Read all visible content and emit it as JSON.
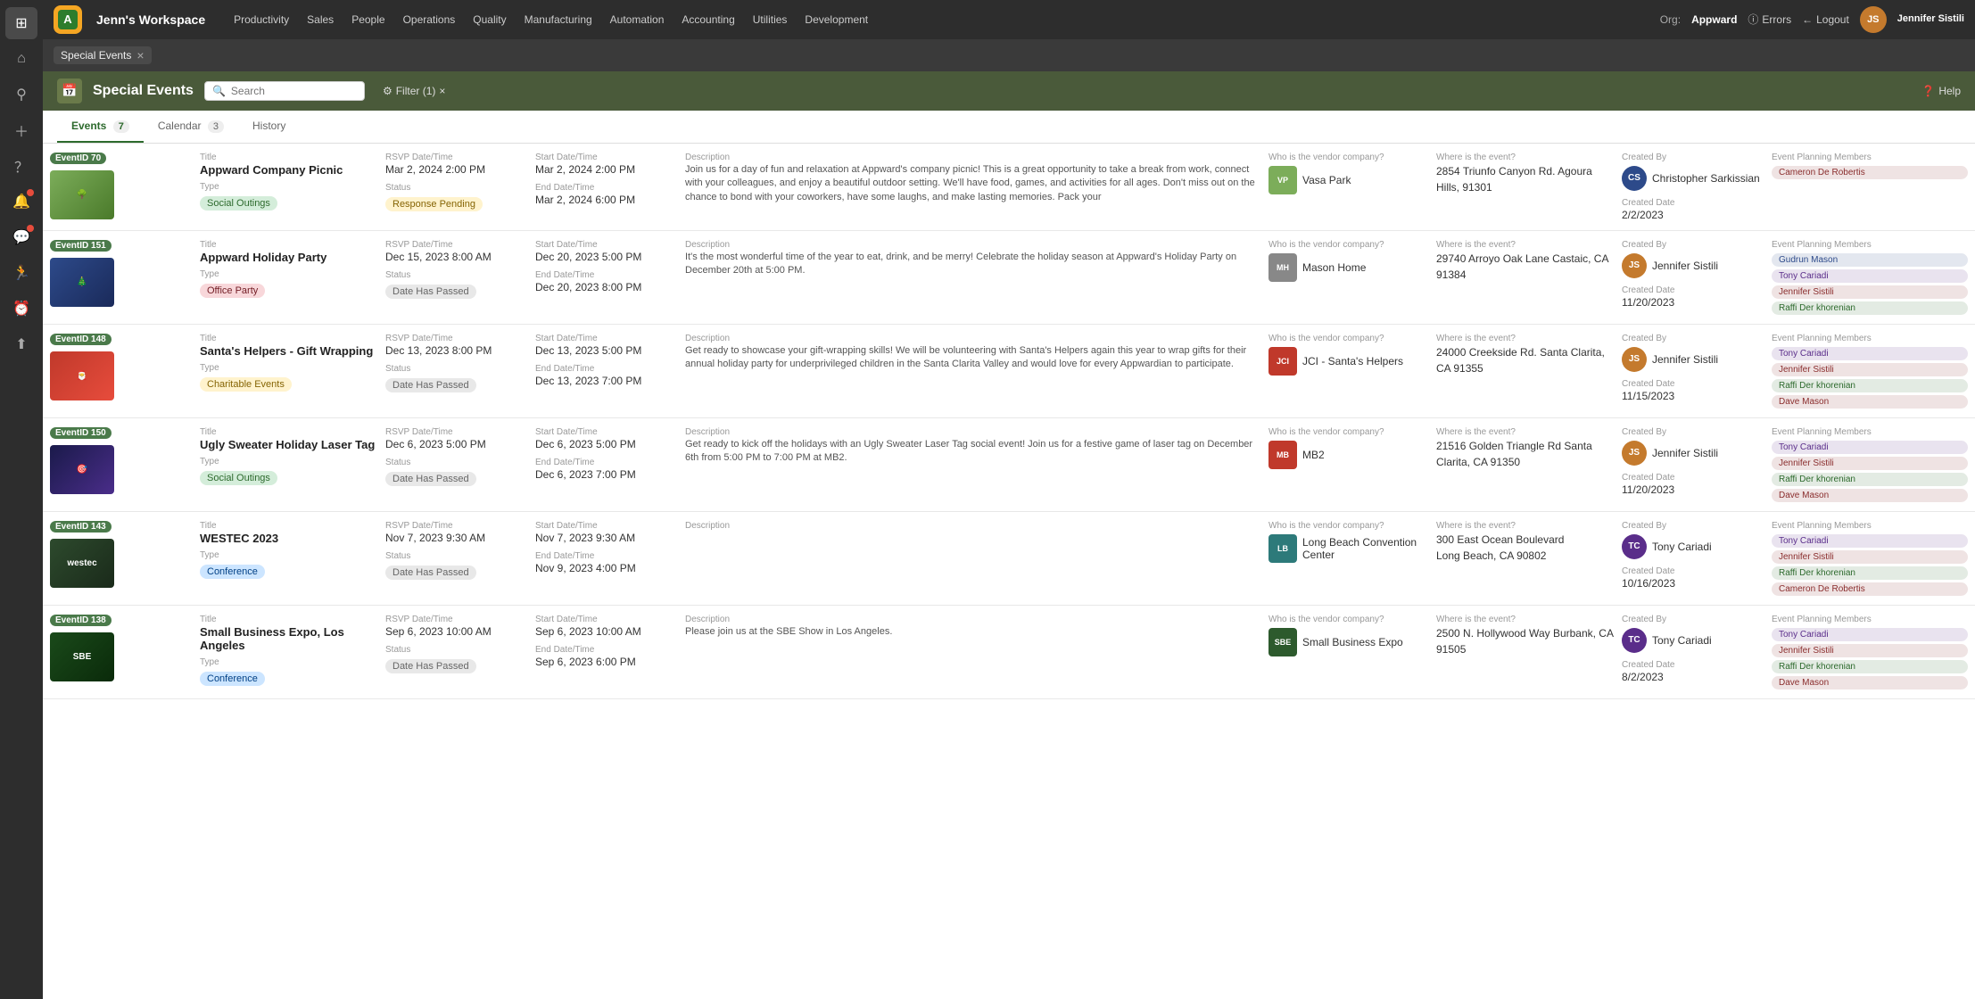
{
  "appLogo": "A",
  "workspaceName": "Jenn's Workspace",
  "nav": {
    "items": [
      {
        "label": "Productivity"
      },
      {
        "label": "Sales"
      },
      {
        "label": "People"
      },
      {
        "label": "Operations"
      },
      {
        "label": "Quality"
      },
      {
        "label": "Manufacturing"
      },
      {
        "label": "Automation"
      },
      {
        "label": "Accounting"
      },
      {
        "label": "Utilities"
      },
      {
        "label": "Development"
      }
    ],
    "org_label": "Org:",
    "org_name": "Appward",
    "errors_label": "Errors",
    "logout_label": "Logout",
    "user_name": "Jennifer Sistili"
  },
  "tagBar": {
    "chip_label": "Special Events",
    "close": "×"
  },
  "moduleHeader": {
    "title": "Special Events",
    "search_placeholder": "Search",
    "filter_label": "Filter (1)",
    "filter_close": "×",
    "help_label": "Help"
  },
  "tabs": [
    {
      "label": "Events",
      "count": "7",
      "active": true
    },
    {
      "label": "Calendar",
      "count": "3",
      "active": false
    },
    {
      "label": "History",
      "count": null,
      "active": false
    }
  ],
  "columnHeaders": [
    "EventID / Image",
    "Title / Type",
    "RSVP Date/Time",
    "Start Date/Time",
    "Description",
    "Who is the vendor company?",
    "Where is the event?",
    "Created By",
    "Event Planning Members"
  ],
  "events": [
    {
      "id": "70",
      "title": "Appward Company Picnic",
      "type": "Social Outings",
      "type_class": "type-social",
      "rsvp_date": "Mar 2, 2024 2:00 PM",
      "start_date": "Mar 2, 2024 2:00 PM",
      "end_date": "Mar 2, 2024 6:00 PM",
      "status": "Response Pending",
      "status_class": "status-pending",
      "description": "Join us for a day of fun and relaxation at Appward's company picnic! This is a great opportunity to take a break from work, connect with your colleagues, and enjoy a beautiful outdoor setting. We'll have food, games, and activities for all ages. Don't miss out on the chance to bond with your coworkers, have some laughs, and make lasting memories. Pack your",
      "vendor_name": "Vasa Park",
      "vendor_color": "#7cad5a",
      "vendor_initials": "VP",
      "location": "2854 Triunfo Canyon Rd. Agoura Hills, 91301",
      "created_by": "Christopher Sarkissian",
      "created_by_initials": "CS",
      "created_by_color": "#2d4a8a",
      "created_date_label": "Created Date",
      "created_date": "2/2/2023",
      "members": [
        "Cameron De Robertis"
      ],
      "img_class": "img-picnic",
      "img_text": "🌳"
    },
    {
      "id": "151",
      "title": "Appward Holiday Party",
      "type": "Office Party",
      "type_class": "type-office",
      "rsvp_date": "Dec 15, 2023 8:00 AM",
      "start_date": "Dec 20, 2023 5:00 PM",
      "end_date": "Dec 20, 2023 8:00 PM",
      "status": "Date Has Passed",
      "status_class": "status-passed",
      "description": "It's the most wonderful time of the year to eat, drink, and be merry!\n\nCelebrate the holiday season at Appward's Holiday Party on December 20th at 5:00 PM.",
      "vendor_name": "Mason Home",
      "vendor_color": "#888",
      "vendor_initials": "MH",
      "location": "29740 Arroyo Oak Lane Castaic, CA 91384",
      "created_by": "Jennifer Sistili",
      "created_by_initials": "JS",
      "created_by_color": "#c47a2d",
      "created_date_label": "Created Date",
      "created_date": "11/20/2023",
      "members": [
        "Gudrun Mason",
        "Tony Cariadi",
        "Jennifer Sistili",
        "Raffi Der khorenian"
      ],
      "img_class": "img-holiday",
      "img_text": "🎄"
    },
    {
      "id": "148",
      "title": "Santa's Helpers - Gift Wrapping",
      "type": "Charitable Events",
      "type_class": "type-charitable",
      "rsvp_date": "Dec 13, 2023 8:00 PM",
      "start_date": "Dec 13, 2023 5:00 PM",
      "end_date": "Dec 13, 2023 7:00 PM",
      "status": "Date Has Passed",
      "status_class": "status-passed",
      "description": "Get ready to showcase your gift-wrapping skills!\n\nWe will be volunteering with Santa's Helpers again this year to wrap gifts for their annual holiday party for underprivileged children in the Santa Clarita Valley and would love for every Appwardian to participate.",
      "vendor_name": "JCI - Santa's Helpers",
      "vendor_color": "#c0392b",
      "vendor_initials": "JCI",
      "location": "24000 Creekside Rd. Santa Clarita, CA 91355",
      "created_by": "Jennifer Sistili",
      "created_by_initials": "JS",
      "created_by_color": "#c47a2d",
      "created_date_label": "Created Date",
      "created_date": "11/15/2023",
      "members": [
        "Tony Cariadi",
        "Jennifer Sistili",
        "Raffi Der khorenian",
        "Dave Mason"
      ],
      "img_class": "img-santa",
      "img_text": "🎅"
    },
    {
      "id": "150",
      "title": "Ugly Sweater Holiday Laser Tag",
      "type": "Social Outings",
      "type_class": "type-social",
      "rsvp_date": "Dec 6, 2023 5:00 PM",
      "start_date": "Dec 6, 2023 5:00 PM",
      "end_date": "Dec 6, 2023 7:00 PM",
      "status": "Date Has Passed",
      "status_class": "status-passed",
      "description": "Get ready to kick off the holidays with an Ugly Sweater Laser Tag social event!\n\nJoin us for a festive game of laser tag on December 6th from 5:00 PM to 7:00 PM at MB2.",
      "vendor_name": "MB2",
      "vendor_color": "#c0392b",
      "vendor_initials": "MB",
      "location": "21516 Golden Triangle Rd Santa Clarita, CA 91350",
      "created_by": "Jennifer Sistili",
      "created_by_initials": "JS",
      "created_by_color": "#c47a2d",
      "created_date_label": "Created Date",
      "created_date": "11/20/2023",
      "members": [
        "Tony Cariadi",
        "Jennifer Sistili",
        "Raffi Der khorenian",
        "Dave Mason"
      ],
      "img_class": "img-laser",
      "img_text": "🎯"
    },
    {
      "id": "143",
      "title": "WESTEC 2023",
      "type": "Conference",
      "type_class": "type-conference",
      "rsvp_date": "Nov 7, 2023 9:30 AM",
      "start_date": "Nov 7, 2023 9:30 AM",
      "end_date": "Nov 9, 2023 4:00 PM",
      "status": "Date Has Passed",
      "status_class": "status-passed",
      "description": "",
      "vendor_name": "Long Beach Convention Center",
      "vendor_color": "#2d7a7a",
      "vendor_initials": "LB",
      "location": "300 East Ocean Boulevard\nLong Beach, CA 90802",
      "created_by": "Tony Cariadi",
      "created_by_initials": "TC",
      "created_by_color": "#5a2d8a",
      "created_date_label": "Created Date",
      "created_date": "10/16/2023",
      "members": [
        "Tony Cariadi",
        "Jennifer Sistili",
        "Raffi Der khorenian",
        "Cameron De Robertis"
      ],
      "img_class": "img-westec",
      "img_text": "westec"
    },
    {
      "id": "138",
      "title": "Small Business Expo, Los Angeles",
      "type": "Conference",
      "type_class": "type-conference",
      "rsvp_date": "Sep 6, 2023 10:00 AM",
      "start_date": "Sep 6, 2023 10:00 AM",
      "end_date": "Sep 6, 2023 6:00 PM",
      "status": "Date Has Passed",
      "status_class": "status-passed",
      "description": "Please join us at the SBE Show in Los Angeles.",
      "vendor_name": "Small Business Expo",
      "vendor_color": "#2d5a2d",
      "vendor_initials": "SBE",
      "location": "2500 N. Hollywood Way Burbank, CA 91505",
      "created_by": "Tony Cariadi",
      "created_by_initials": "TC",
      "created_by_color": "#5a2d8a",
      "created_date_label": "Created Date",
      "created_date": "8/2/2023",
      "members": [
        "Tony Cariadi",
        "Jennifer Sistili",
        "Raffi Der khorenian",
        "Dave Mason"
      ],
      "img_class": "img-sbe",
      "img_text": "SBE"
    }
  ],
  "sidebarIcons": [
    {
      "name": "grid-icon",
      "symbol": "⊞",
      "active": true
    },
    {
      "name": "home-icon",
      "symbol": "⌂",
      "active": false
    },
    {
      "name": "search-icon",
      "symbol": "🔍",
      "active": false
    },
    {
      "name": "plus-icon",
      "symbol": "+",
      "active": false
    },
    {
      "name": "question-icon",
      "symbol": "?",
      "active": false
    },
    {
      "name": "bell-icon",
      "symbol": "🔔",
      "active": false,
      "badge": true
    },
    {
      "name": "chat-icon",
      "symbol": "💬",
      "active": false,
      "badge": true
    },
    {
      "name": "person-icon",
      "symbol": "🏃",
      "active": false
    },
    {
      "name": "clock-icon",
      "symbol": "⏰",
      "active": false
    },
    {
      "name": "upload-icon",
      "symbol": "⬆",
      "active": false
    }
  ]
}
